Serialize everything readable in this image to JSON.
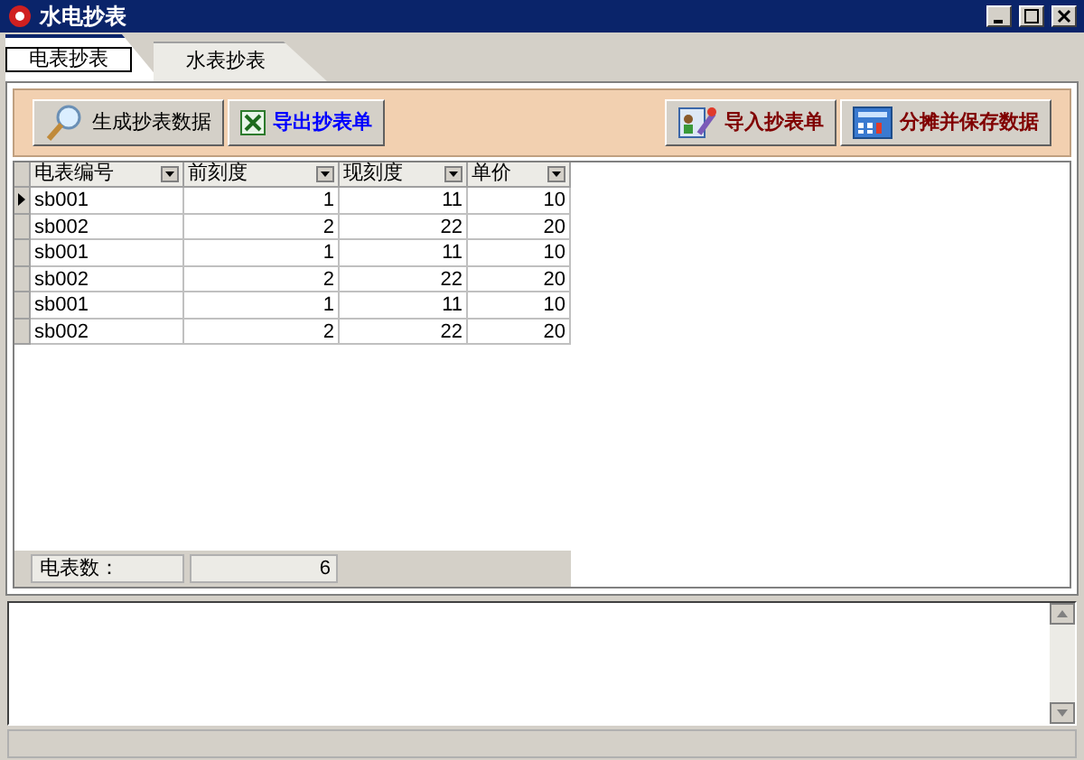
{
  "window": {
    "title": "水电抄表"
  },
  "tabs": [
    {
      "label": "电表抄表",
      "selected": true
    },
    {
      "label": "水表抄表",
      "selected": false
    }
  ],
  "toolbar": {
    "left": [
      {
        "label": "生成抄表数据",
        "kind": "search",
        "color": "#000000"
      },
      {
        "label": "导出抄表单",
        "kind": "excel",
        "color": "#0000ff"
      }
    ],
    "right": [
      {
        "label": "导入抄表单",
        "kind": "import",
        "color": "#800000"
      },
      {
        "label": "分摊并保存数据",
        "kind": "calc",
        "color": "#800000"
      }
    ]
  },
  "table": {
    "columns": [
      "电表编号",
      "前刻度",
      "现刻度",
      "单价"
    ],
    "rows": [
      {
        "cells": [
          "sb001",
          "1",
          "11",
          "10"
        ],
        "selected": true
      },
      {
        "cells": [
          "sb002",
          "2",
          "22",
          "20"
        ],
        "selected": false
      },
      {
        "cells": [
          "sb001",
          "1",
          "11",
          "10"
        ],
        "selected": false
      },
      {
        "cells": [
          "sb002",
          "2",
          "22",
          "20"
        ],
        "selected": false
      },
      {
        "cells": [
          "sb001",
          "1",
          "11",
          "10"
        ],
        "selected": false
      },
      {
        "cells": [
          "sb002",
          "2",
          "22",
          "20"
        ],
        "selected": false
      }
    ]
  },
  "summary": {
    "label": "电表数：",
    "value": "6"
  }
}
